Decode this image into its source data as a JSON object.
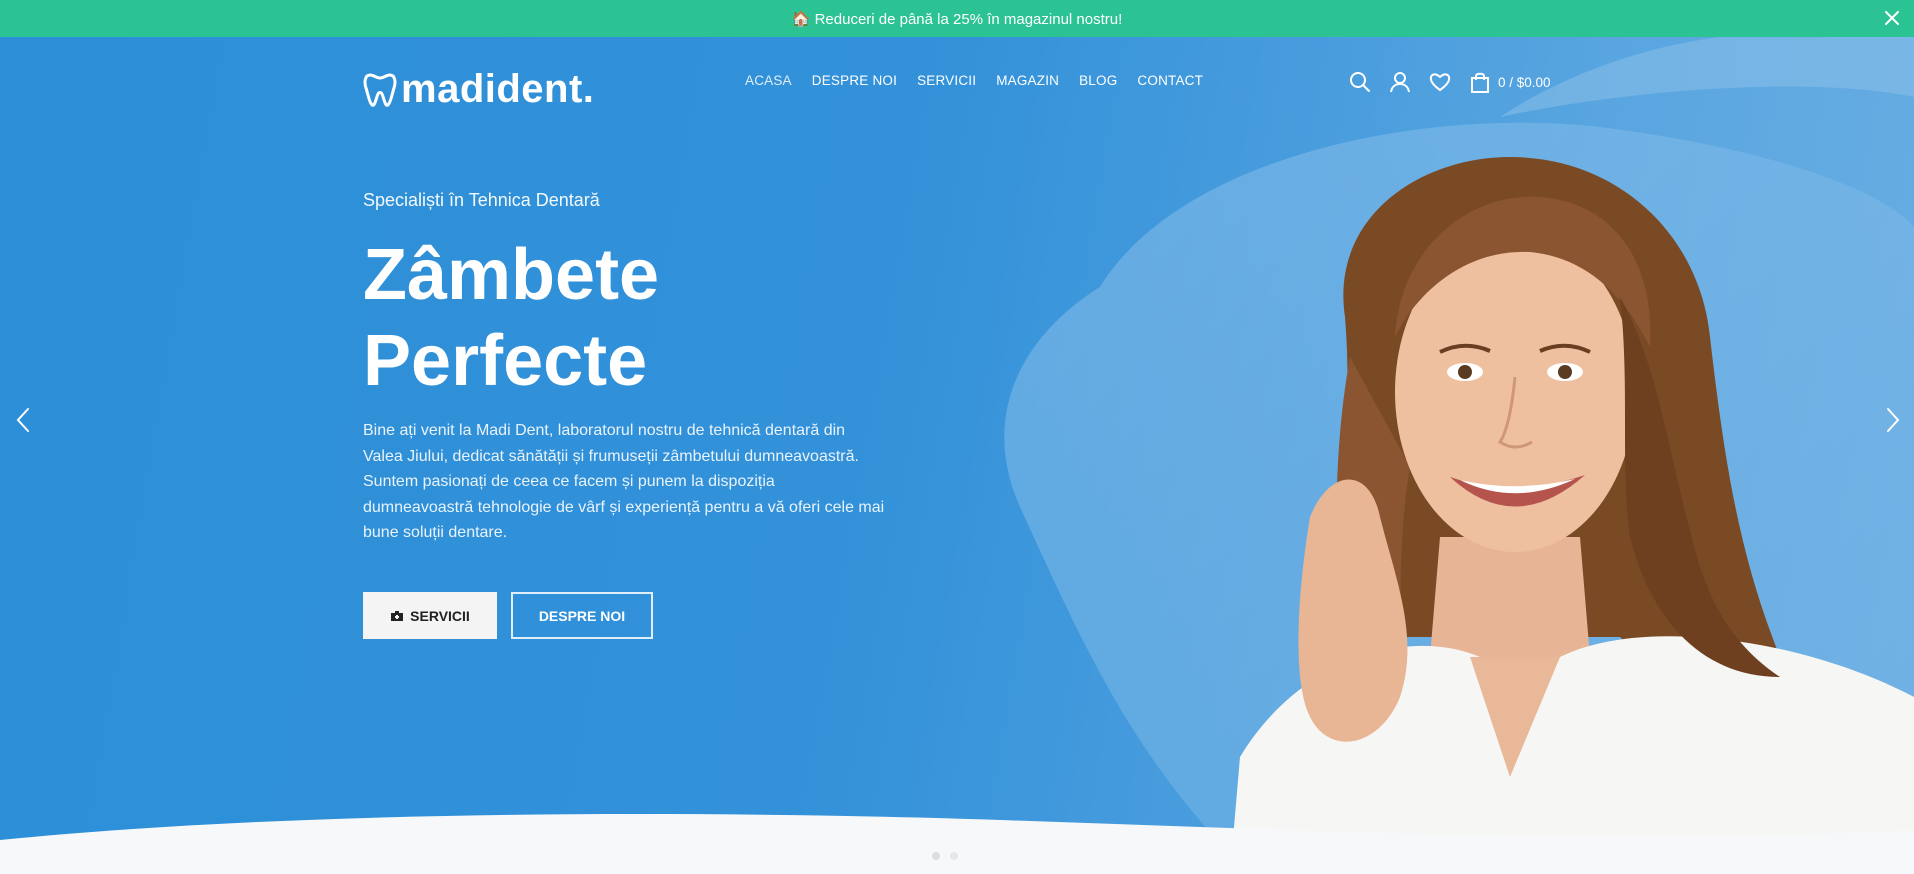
{
  "promo": {
    "emoji": "🏠",
    "text": "Reduceri de până la 25% în magazinul nostru!",
    "close_icon": "close-icon"
  },
  "brand": {
    "name": "madident.",
    "logo_icon": "tooth-icon"
  },
  "nav": {
    "items": [
      {
        "label": "ACASA"
      },
      {
        "label": "DESPRE NOI"
      },
      {
        "label": "SERVICII"
      },
      {
        "label": "MAGAZIN"
      },
      {
        "label": "BLOG"
      },
      {
        "label": "CONTACT"
      }
    ]
  },
  "header_icons": {
    "search": "search-icon",
    "account": "user-icon",
    "wishlist": "heart-icon",
    "cart": "shopping-bag-icon",
    "cart_text": "0 / $0.00"
  },
  "hero": {
    "subtitle": "Specialiști în Tehnica Dentară",
    "headline_line1": "Zâmbete",
    "headline_line2": "Perfecte",
    "description": "Bine ați venit la Madi Dent, laboratorul nostru de tehnică dentară din Valea Jiului, dedicat sănătății și frumuseții zâmbetului dumneavoastră. Suntem pasionați de ceea ce facem și punem la dispoziția dumneavoastră tehnologie de vârf și experiență pentru a vă oferi cele mai bune soluții dentare.",
    "primary_button": "SERVICII",
    "primary_button_icon": "medkit-icon",
    "secondary_button": "DESPRE NOI"
  },
  "slider": {
    "prev_icon": "chevron-left-icon",
    "next_icon": "chevron-right-icon"
  },
  "colors": {
    "promo_bg": "#2bc294",
    "hero_bg": "#2c8fd8",
    "text_light": "#ffffff"
  }
}
